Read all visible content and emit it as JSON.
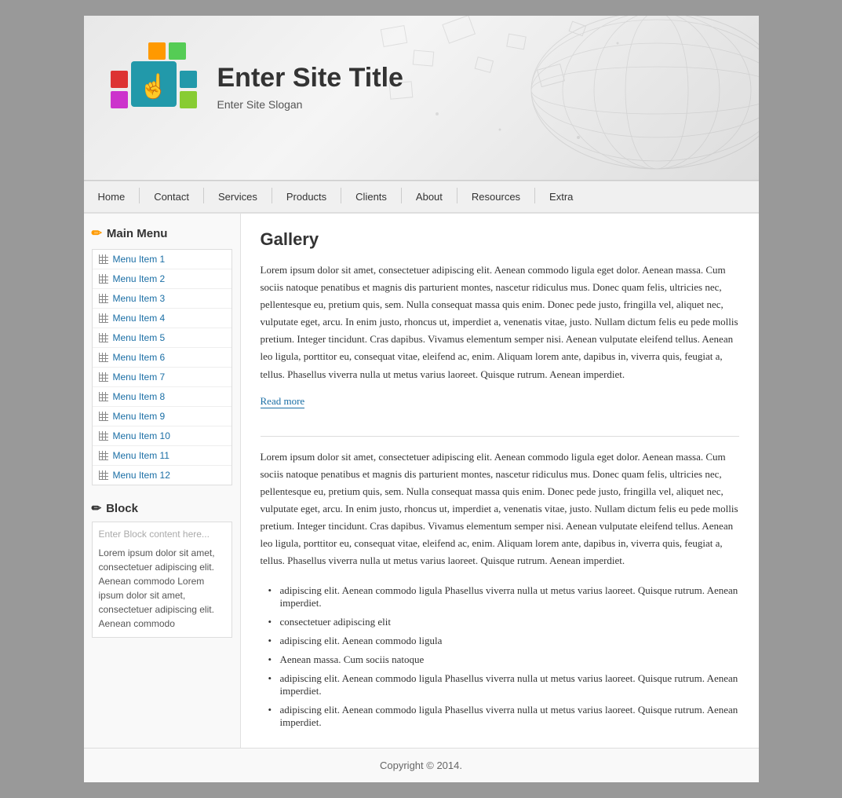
{
  "site": {
    "title": "Enter Site Title",
    "slogan": "Enter Site Slogan"
  },
  "nav": {
    "items": [
      {
        "label": "Home"
      },
      {
        "label": "Contact"
      },
      {
        "label": "Services"
      },
      {
        "label": "Products"
      },
      {
        "label": "Clients"
      },
      {
        "label": "About"
      },
      {
        "label": "Resources"
      },
      {
        "label": "Extra"
      }
    ]
  },
  "sidebar": {
    "menu_title": "Main Menu",
    "menu_items": [
      {
        "label": "Menu Item 1"
      },
      {
        "label": "Menu Item 2"
      },
      {
        "label": "Menu Item 3"
      },
      {
        "label": "Menu Item 4"
      },
      {
        "label": "Menu Item 5"
      },
      {
        "label": "Menu Item 6"
      },
      {
        "label": "Menu Item 7"
      },
      {
        "label": "Menu Item 8"
      },
      {
        "label": "Menu Item 9"
      },
      {
        "label": "Menu Item 10"
      },
      {
        "label": "Menu Item 11"
      },
      {
        "label": "Menu Item 12"
      }
    ],
    "block_title": "Block",
    "block_enter": "Enter Block content here...",
    "block_lorem": "Lorem ipsum dolor sit amet, consectetuer adipiscing elit. Aenean commodo Lorem ipsum dolor sit amet, consectetuer adipiscing elit. Aenean commodo"
  },
  "main": {
    "page_title": "Gallery",
    "para1": "Lorem ipsum dolor sit amet, consectetuer adipiscing elit. Aenean commodo ligula eget dolor. Aenean massa. Cum sociis natoque penatibus et magnis dis parturient montes, nascetur ridiculus mus. Donec quam felis, ultricies nec, pellentesque eu, pretium quis, sem. Nulla consequat massa quis enim. Donec pede justo, fringilla vel, aliquet nec, vulputate eget, arcu. In enim justo, rhoncus ut, imperdiet a, venenatis vitae, justo. Nullam dictum felis eu pede mollis pretium. Integer tincidunt. Cras dapibus. Vivamus elementum semper nisi. Aenean vulputate eleifend tellus. Aenean leo ligula, porttitor eu, consequat vitae, eleifend ac, enim. Aliquam lorem ante, dapibus in, viverra quis, feugiat a, tellus. Phasellus viverra nulla ut metus varius laoreet. Quisque rutrum. Aenean imperdiet.",
    "read_more": "Read more",
    "para2": "Lorem ipsum dolor sit amet, consectetuer adipiscing elit. Aenean commodo ligula eget dolor. Aenean massa. Cum sociis natoque penatibus et magnis dis parturient montes, nascetur ridiculus mus. Donec quam felis, ultricies nec, pellentesque eu, pretium quis, sem. Nulla consequat massa quis enim. Donec pede justo, fringilla vel, aliquet nec, vulputate eget, arcu. In enim justo, rhoncus ut, imperdiet a, venenatis vitae, justo. Nullam dictum felis eu pede mollis pretium. Integer tincidunt. Cras dapibus. Vivamus elementum semper nisi. Aenean vulputate eleifend tellus. Aenean leo ligula, porttitor eu, consequat vitae, eleifend ac, enim. Aliquam lorem ante, dapibus in, viverra quis, feugiat a, tellus. Phasellus viverra nulla ut metus varius laoreet. Quisque rutrum. Aenean imperdiet.",
    "bullets": [
      "adipiscing elit. Aenean commodo ligula Phasellus viverra nulla ut metus varius laoreet. Quisque rutrum. Aenean imperdiet.",
      "consectetuer adipiscing elit",
      "adipiscing elit. Aenean commodo ligula",
      "Aenean massa. Cum sociis natoque",
      "adipiscing elit. Aenean commodo ligula Phasellus viverra nulla ut metus varius laoreet. Quisque rutrum. Aenean imperdiet.",
      "adipiscing elit. Aenean commodo ligula Phasellus viverra nulla ut metus varius laoreet. Quisque rutrum. Aenean imperdiet."
    ]
  },
  "footer": {
    "text": "Copyright © 2014."
  }
}
